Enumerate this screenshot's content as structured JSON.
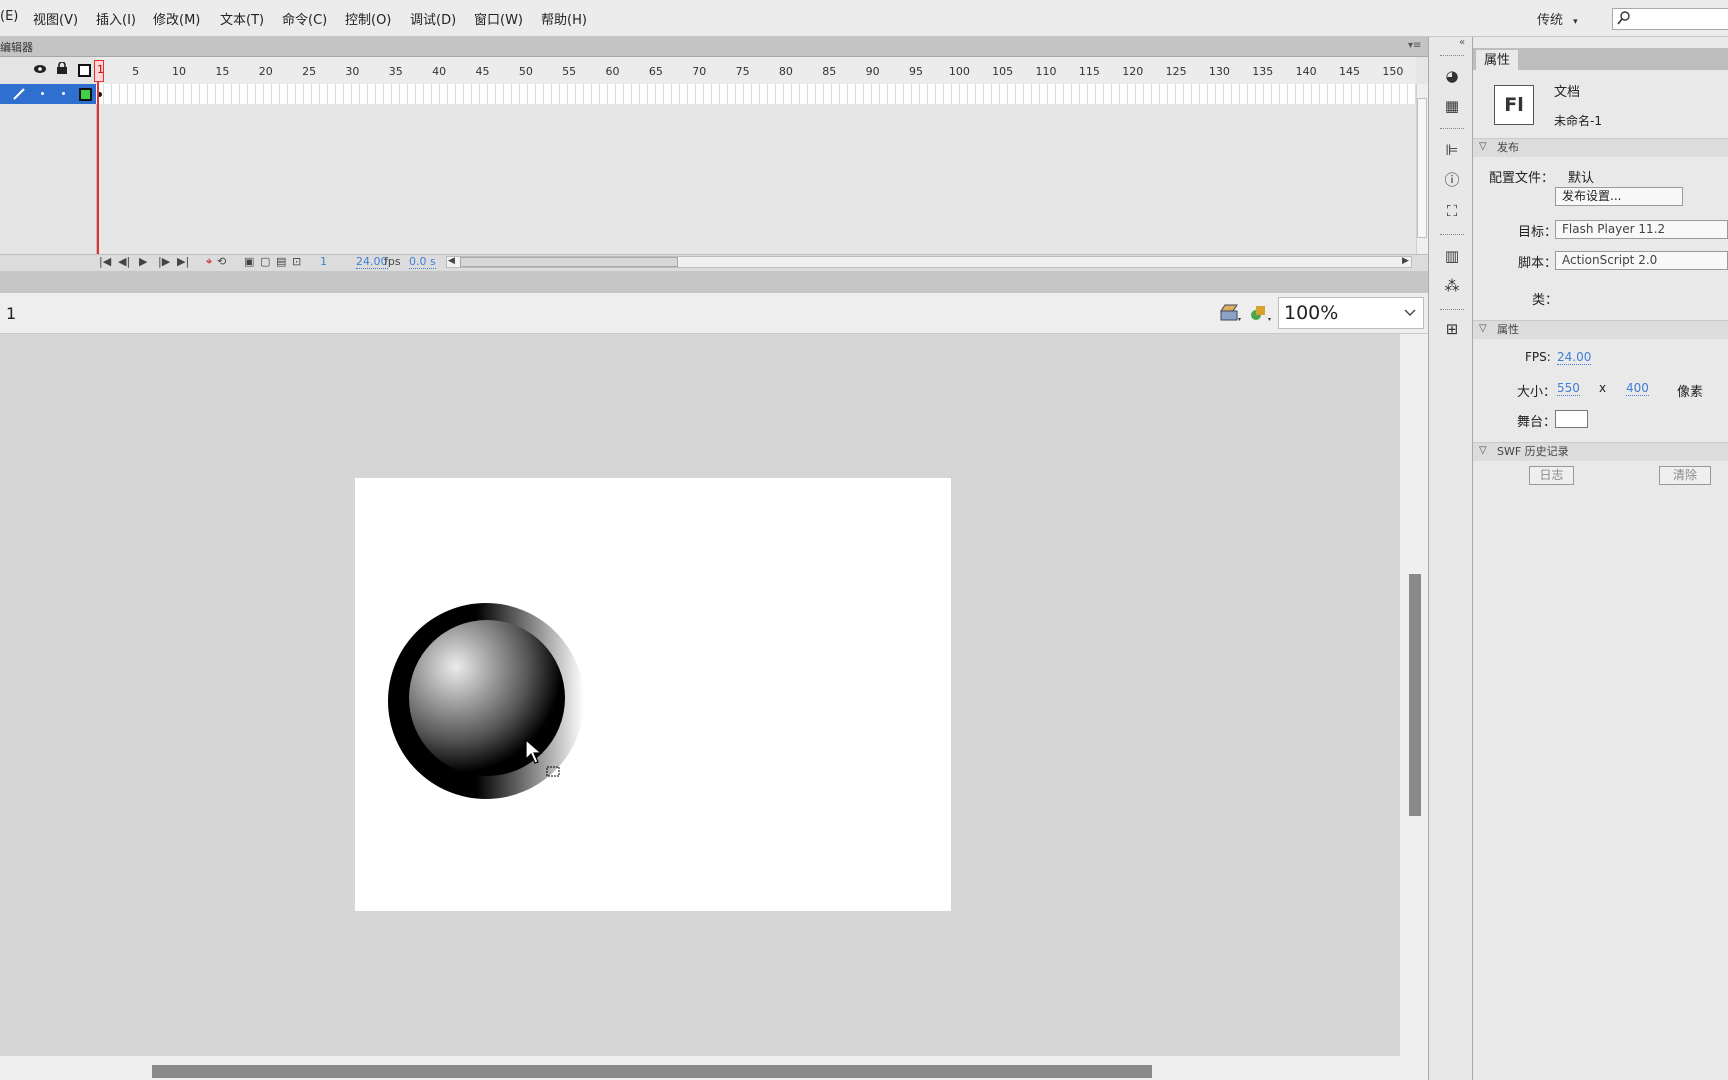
{
  "menubar": {
    "items": [
      "(E)",
      "视图(V)",
      "插入(I)",
      "修改(M)",
      "文本(T)",
      "命令(C)",
      "控制(O)",
      "调试(D)",
      "窗口(W)",
      "帮助(H)"
    ],
    "workspace": "传统",
    "workspace_chevron": "▾",
    "search_icon": "search-icon"
  },
  "timeline": {
    "panel_title": "编辑器",
    "frame_numbers": [
      "1",
      "5",
      "10",
      "15",
      "20",
      "25",
      "30",
      "35",
      "40",
      "45",
      "50",
      "55",
      "60",
      "65",
      "70",
      "75",
      "80",
      "85",
      "90",
      "95",
      "100",
      "105",
      "110",
      "115",
      "120",
      "125",
      "130",
      "135",
      "140",
      "145",
      "150"
    ],
    "current_frame": "1",
    "fps": "24.00",
    "fps_unit": "fps",
    "elapsed": "0.0 s",
    "layer_icons": [
      "eye-icon",
      "lock-icon",
      "outline-icon"
    ]
  },
  "editbar": {
    "scene": "1",
    "zoom": "100%"
  },
  "stage": {
    "background": "#ffffff",
    "pasteboard": "#d6d6d6"
  },
  "properties": {
    "tab": "属性",
    "doc_icon": "Fl",
    "doc_type": "文档",
    "doc_name": "未命名-1",
    "publish": {
      "section": "发布",
      "profile_label": "配置文件：",
      "profile_value": "默认",
      "settings_button": "发布设置...",
      "target_label": "目标：",
      "target_value": "Flash Player 11.2",
      "script_label": "脚本：",
      "script_value": "ActionScript 2.0",
      "class_label": "类："
    },
    "props": {
      "section": "属性",
      "fps_label": "FPS:",
      "fps_value": "24.00",
      "size_label": "大小：",
      "width": "550",
      "x": "x",
      "height": "400",
      "unit": "像素",
      "stage_label": "舞台："
    },
    "swf": {
      "section": "SWF 历史记录",
      "log_button": "日志",
      "clear_button": "清除"
    }
  },
  "colors": {
    "playhead": "#e03030",
    "layer_selected": "#2f6fd0",
    "link": "#3f7fd7"
  }
}
